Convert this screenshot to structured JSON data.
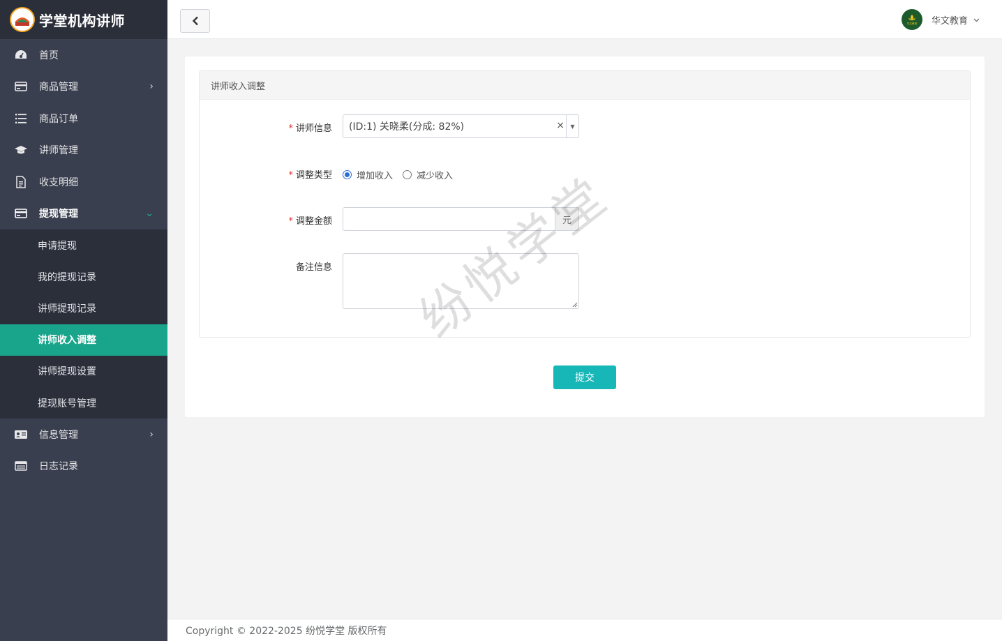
{
  "brand": {
    "title": "学堂机构讲师",
    "logo_text": "纷悦学堂"
  },
  "sidebar": {
    "items": [
      {
        "label": "首页",
        "icon": "dashboard-icon"
      },
      {
        "label": "商品管理",
        "icon": "card-icon",
        "arrow": "›"
      },
      {
        "label": "商品订单",
        "icon": "list-icon"
      },
      {
        "label": "讲师管理",
        "icon": "graduation-cap-icon"
      },
      {
        "label": "收支明细",
        "icon": "document-icon"
      },
      {
        "label": "提现管理",
        "icon": "card-icon",
        "arrow": "⌄"
      },
      {
        "label": "信息管理",
        "icon": "id-card-icon",
        "arrow": "›"
      },
      {
        "label": "日志记录",
        "icon": "table-icon"
      }
    ],
    "submenu": [
      "申请提现",
      "我的提现记录",
      "讲师提现记录",
      "讲师收入调整",
      "讲师提现设置",
      "提现账号管理"
    ]
  },
  "topbar": {
    "user_name": "华文教育",
    "avatar_text": "华文教育"
  },
  "form": {
    "panel_title": "讲师收入调整",
    "required_mark": "*",
    "teacher_label": "讲师信息",
    "teacher_value": "(ID:1) 关晓柔(分成: 82%)",
    "clear_symbol": "×",
    "type_label": "调整类型",
    "type_options": [
      "增加收入",
      "减少收入"
    ],
    "type_selected": 0,
    "amount_label": "调整金额",
    "amount_value": "",
    "amount_unit": "元",
    "remark_label": "备注信息",
    "remark_value": "",
    "submit_label": "提交"
  },
  "watermark": "纷悦学堂",
  "footer": {
    "copyright": "Copyright © 2022-2025 纷悦学堂 版权所有"
  },
  "colors": {
    "sidebar": "#3a3f4f",
    "sidebar_dark": "#2b2f3a",
    "active": "#19a58b",
    "submit": "#17b6b7"
  }
}
